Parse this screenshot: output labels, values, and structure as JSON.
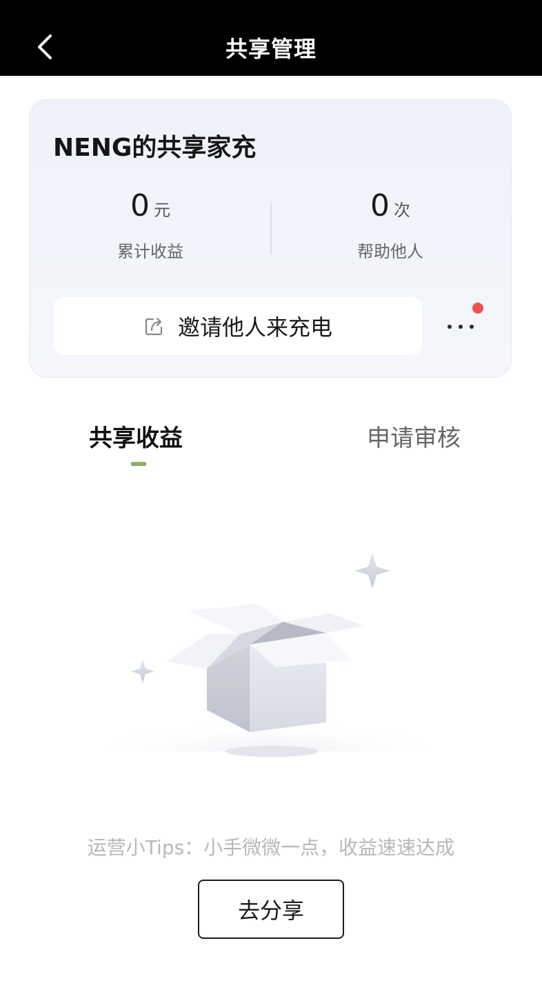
{
  "header": {
    "title": "共享管理",
    "back_icon": "chevron-left-icon"
  },
  "card": {
    "title": "NENG的共享家充",
    "earnings": {
      "value": "0",
      "unit": "元",
      "label": "累计收益"
    },
    "helped": {
      "value": "0",
      "unit": "次",
      "label": "帮助他人"
    },
    "invite_button": {
      "label": "邀请他人来充电",
      "icon": "share-icon"
    },
    "more_icon": "more-dots-icon",
    "notification_color": "#f2504f"
  },
  "tabs": [
    {
      "label": "共享收益",
      "active": true
    },
    {
      "label": "申请审核",
      "active": false
    }
  ],
  "accent_color": "#8bb06a",
  "empty_state": {
    "illustration": "empty-box-illustration",
    "tips": "运营小Tips：小手微微一点，收益速速达成",
    "share_button": "去分享"
  }
}
